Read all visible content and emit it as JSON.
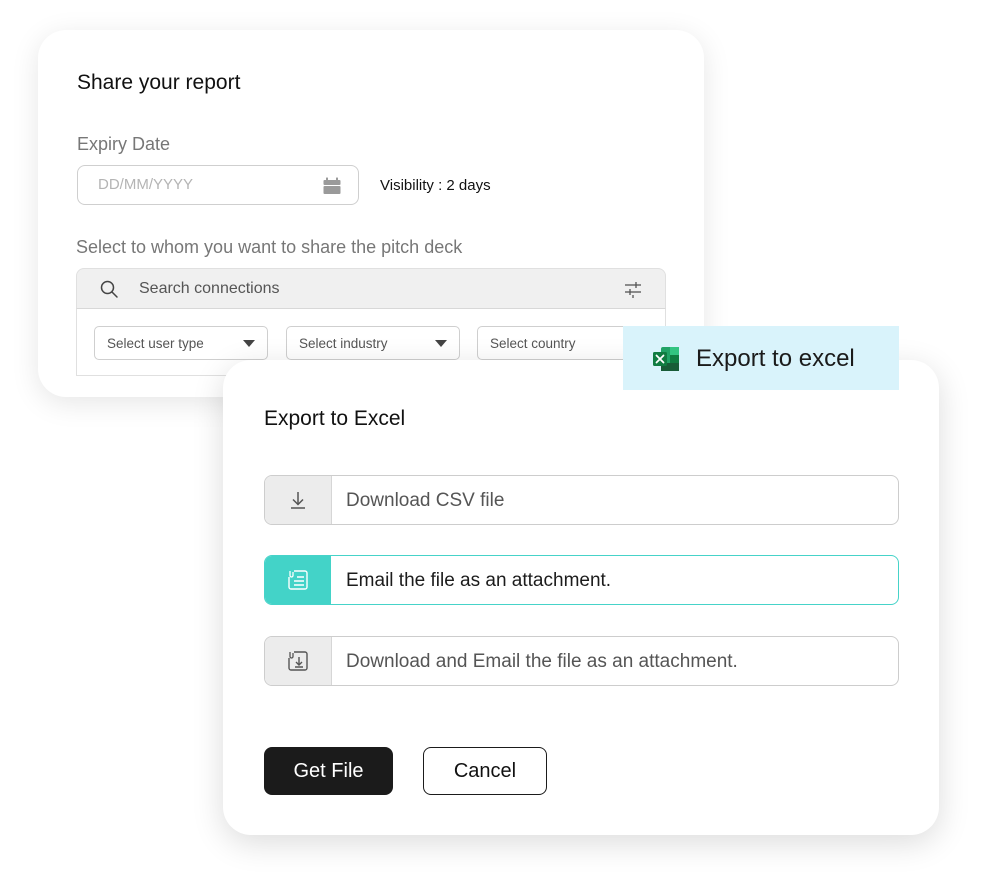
{
  "share": {
    "title": "Share your report",
    "expiry_label": "Expiry Date",
    "date_placeholder": "DD/MM/YYYY",
    "calendar_icon": "calendar-icon",
    "visibility": "Visibility : 2 days",
    "prompt": "Select to whom you want to share the pitch deck",
    "search_placeholder": "Search connections",
    "search_icon": "search-icon",
    "filter_icon": "filter-sliders-icon",
    "selects": [
      {
        "label": "Select user type"
      },
      {
        "label": "Select industry"
      },
      {
        "label": "Select country"
      }
    ]
  },
  "badge": {
    "icon": "excel-icon",
    "label": "Export to excel"
  },
  "export": {
    "title": "Export to Excel",
    "options": [
      {
        "label": "Download CSV file",
        "icon": "download-icon",
        "selected": false
      },
      {
        "label": "Email the file as an attachment.",
        "icon": "email-attachment-icon",
        "selected": true
      },
      {
        "label": "Download and Email the file as an attachment.",
        "icon": "download-attachment-icon",
        "selected": false
      }
    ],
    "primary_button": "Get File",
    "secondary_button": "Cancel"
  },
  "colors": {
    "accent": "#43d3c8",
    "badge_bg": "#d9f3fb",
    "primary_button_bg": "#1b1b1b",
    "excel_green": "#1f7a45"
  }
}
